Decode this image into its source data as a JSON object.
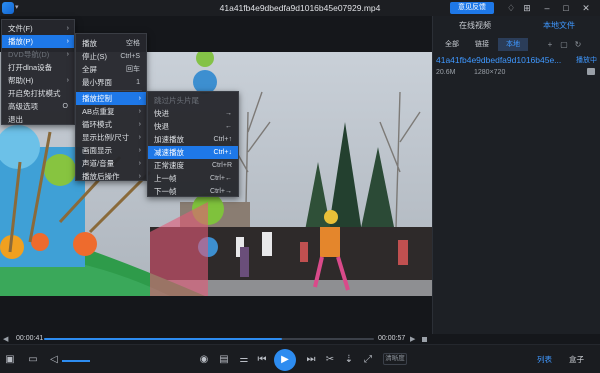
{
  "titlebar": {
    "title": "41a41fb4e9dbedfa9d1016b45e07929.mp4",
    "feedback_label": "意见反馈"
  },
  "panel": {
    "tabs": [
      {
        "label": "在线视频"
      },
      {
        "label": "本地文件"
      }
    ],
    "subtabs": [
      {
        "label": "全部"
      },
      {
        "label": "链接"
      },
      {
        "label": "本地"
      }
    ],
    "file": {
      "name": "41a41fb4e9dbedfa9d1016b45e...",
      "status": "播放中",
      "size": "20.6M",
      "resolution": "1280×720"
    }
  },
  "progress": {
    "current_time": "00:00:41",
    "total_time": "00:00:57",
    "fraction": 0.72
  },
  "bottombar": {
    "speed_label": "清晰度",
    "list_label": "列表",
    "box_label": "盒子"
  },
  "menu_main": {
    "items": [
      {
        "label": "文件(F)",
        "has_submenu": true
      },
      {
        "label": "播放(P)",
        "has_submenu": true,
        "highlighted": true
      },
      {
        "label": "DVD导航(D)",
        "has_submenu": true,
        "disabled": true
      },
      {
        "label": "打开dlna设备"
      },
      {
        "label": "帮助(H)",
        "has_submenu": true
      },
      {
        "label": "开启免打扰模式"
      },
      {
        "label": "高级选项",
        "shortcut": "O"
      },
      {
        "label": "退出"
      }
    ]
  },
  "menu_play": {
    "items": [
      {
        "label": "播放",
        "shortcut": "空格"
      },
      {
        "label": "停止(S)",
        "shortcut": "Ctrl+S"
      },
      {
        "label": "全屏",
        "shortcut": "回车"
      },
      {
        "label": "最小界面",
        "shortcut": "1"
      },
      {
        "label": "播放控制",
        "has_submenu": true,
        "highlighted": true
      },
      {
        "label": "AB点重复",
        "has_submenu": true
      },
      {
        "label": "循环模式",
        "has_submenu": true
      },
      {
        "label": "显示比例/尺寸",
        "has_submenu": true
      },
      {
        "label": "画面显示",
        "has_submenu": true
      },
      {
        "label": "声道/音量",
        "has_submenu": true
      },
      {
        "label": "播放后操作",
        "has_submenu": true
      }
    ]
  },
  "menu_control": {
    "items": [
      {
        "label": "跳过片头片尾",
        "disabled": true
      },
      {
        "label": "快进",
        "shortcut": "→"
      },
      {
        "label": "快退",
        "shortcut": "←"
      },
      {
        "label": "加速播放",
        "shortcut": "Ctrl+↑"
      },
      {
        "label": "减速播放",
        "shortcut": "Ctrl+↓",
        "highlighted": true
      },
      {
        "label": "正常速度",
        "shortcut": "Ctrl+R"
      },
      {
        "label": "上一帧",
        "shortcut": "Ctrl+←"
      },
      {
        "label": "下一帧",
        "shortcut": "Ctrl+→"
      }
    ]
  }
}
